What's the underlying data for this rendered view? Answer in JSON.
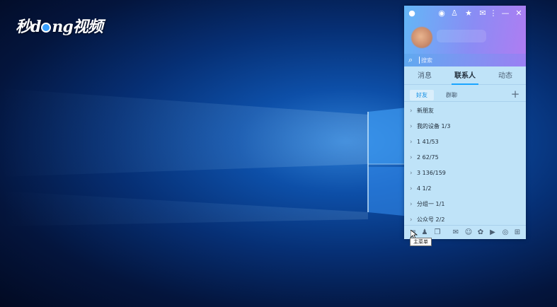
{
  "watermark": {
    "pre": "秒",
    "mid": "ng",
    "post": "视频"
  },
  "qq": {
    "titlebar_icons": [
      "qq-penguin-icon",
      "bell-icon",
      "shirt-icon",
      "star-badge-icon",
      "mail-icon",
      "more-icon",
      "minimize-icon",
      "close-icon"
    ],
    "search": {
      "placeholder": "搜索"
    },
    "tabs": [
      {
        "label": "消息",
        "active": false
      },
      {
        "label": "联系人",
        "active": true
      },
      {
        "label": "动态",
        "active": false
      }
    ],
    "subtabs": [
      {
        "label": "好友",
        "active": true
      },
      {
        "label": "群聊",
        "active": false
      }
    ],
    "groups": [
      {
        "label": "新朋友"
      },
      {
        "label": "我的设备 1/3"
      },
      {
        "label": "1 41/53"
      },
      {
        "label": "2 62/75"
      },
      {
        "label": "3 136/159"
      },
      {
        "label": "4 1/2"
      },
      {
        "label": "分组一 1/1"
      },
      {
        "label": "公众号 2/2"
      }
    ],
    "bottom_icons": [
      "main-menu-icon",
      "add-contact-icon",
      "apps-icon",
      "mail-icon",
      "user-group-icon",
      "settings-icon",
      "video-icon",
      "music-icon",
      "grid-icon"
    ],
    "tooltip": "主菜单"
  }
}
